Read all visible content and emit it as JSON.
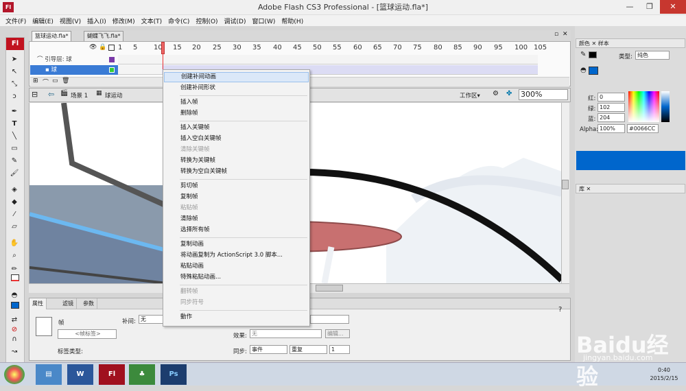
{
  "window": {
    "title": "Adobe Flash CS3 Professional - [篮球运动.fla*]",
    "app_icon": "Fl",
    "minimize": "—",
    "maximize": "❐",
    "close": "✕"
  },
  "menu": [
    "文件(F)",
    "编辑(E)",
    "视图(V)",
    "插入(I)",
    "修改(M)",
    "文本(T)",
    "命令(C)",
    "控制(O)",
    "调试(D)",
    "窗口(W)",
    "帮助(H)"
  ],
  "doc_tabs": [
    "篮球运动.fla*",
    "蝴蝶飞飞.fla*"
  ],
  "timeline": {
    "frame_numbers": [
      "1",
      "5",
      "10",
      "15",
      "20",
      "25",
      "30",
      "35",
      "40",
      "45",
      "50",
      "55",
      "60",
      "65",
      "70",
      "75",
      "80",
      "85",
      "90",
      "95",
      "100",
      "105"
    ],
    "layers": [
      {
        "name": "引导层: 球"
      },
      {
        "name": "球"
      }
    ],
    "current_frame": "10"
  },
  "edit_bar": {
    "scene": "场景 1",
    "symbol": "球运动",
    "workspace": "工作区▾",
    "zoom": "300%"
  },
  "context_menu": {
    "items": [
      {
        "label": "创建补间动画",
        "enabled": true,
        "highlight": true
      },
      {
        "label": "创建补间形状",
        "enabled": true
      },
      {
        "sep": true
      },
      {
        "label": "插入帧",
        "enabled": true
      },
      {
        "label": "删除帧",
        "enabled": true
      },
      {
        "sep": true
      },
      {
        "label": "插入关键帧",
        "enabled": true
      },
      {
        "label": "插入空白关键帧",
        "enabled": true
      },
      {
        "label": "清除关键帧",
        "enabled": false
      },
      {
        "label": "转换为关键帧",
        "enabled": true
      },
      {
        "label": "转换为空白关键帧",
        "enabled": true
      },
      {
        "sep": true
      },
      {
        "label": "剪切帧",
        "enabled": true
      },
      {
        "label": "复制帧",
        "enabled": true
      },
      {
        "label": "粘贴帧",
        "enabled": false
      },
      {
        "label": "清除帧",
        "enabled": true
      },
      {
        "label": "选择所有帧",
        "enabled": true
      },
      {
        "sep": true
      },
      {
        "label": "复制动画",
        "enabled": true
      },
      {
        "label": "将动画复制为 ActionScript 3.0 脚本...",
        "enabled": true
      },
      {
        "label": "粘贴动画",
        "enabled": true
      },
      {
        "label": "特殊粘贴动画...",
        "enabled": true
      },
      {
        "sep": true
      },
      {
        "label": "翻转帧",
        "enabled": false
      },
      {
        "label": "同步符号",
        "enabled": false
      },
      {
        "sep": true
      },
      {
        "label": "動作",
        "enabled": true
      }
    ]
  },
  "properties": {
    "tabs": [
      "属性",
      "滤镜",
      "参数"
    ],
    "frame_label": "帧",
    "frame_label_placeholder": "<帧标签>",
    "label_type": "标签类型:",
    "tween_label": "补间:",
    "tween_value": "无",
    "effect_label": "效果:",
    "effect_value": "无",
    "edit_button": "编辑...",
    "sync_label": "同步:",
    "sync_value": "事件",
    "repeat_value": "重复",
    "repeat_count": "1"
  },
  "color_panel": {
    "tabs": [
      "颜色",
      "样本"
    ],
    "type_label": "类型:",
    "type_value": "纯色",
    "red_label": "红:",
    "red": "0",
    "green_label": "绿:",
    "green": "102",
    "blue_label": "蓝:",
    "blue": "204",
    "alpha_label": "Alpha:",
    "alpha": "100%",
    "hex": "#0066CC",
    "swatch_color": "#0066CC"
  },
  "library_panel": {
    "tab": "库"
  },
  "taskbar": {
    "apps": [
      "W",
      "Fl",
      "Ps"
    ],
    "time": "0:40",
    "date": "2015/2/15"
  },
  "watermark": {
    "text": "Baidu经验",
    "url": "jingyan.baidu.com"
  }
}
